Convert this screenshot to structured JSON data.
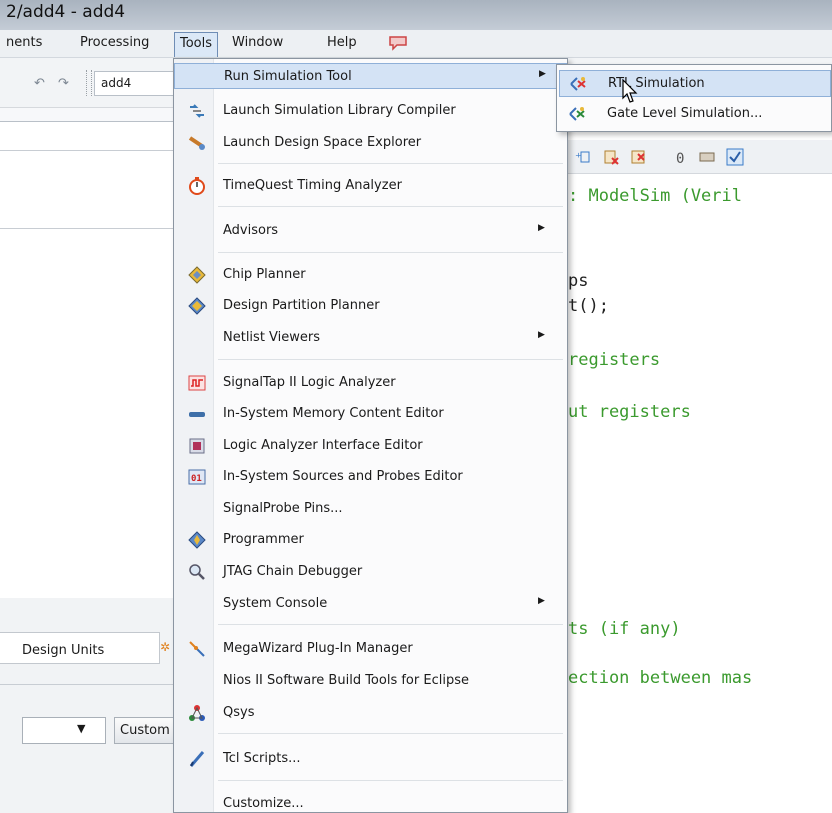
{
  "window": {
    "title": "2/add4 - add4"
  },
  "menubar": {
    "items": [
      "nents",
      "Processing",
      "Tools",
      "Window",
      "Help"
    ],
    "active": "Tools",
    "icon": "chat-bubble-icon"
  },
  "toolbar": {
    "undo_icon": "undo-icon",
    "redo_icon": "redo-icon",
    "project_value": "add4"
  },
  "tools_menu": {
    "items": [
      {
        "label": "Run Simulation Tool",
        "icon": "",
        "submenu": true,
        "highlighted": true
      },
      {
        "label": "Launch Simulation Library Compiler",
        "icon": "library-compiler-icon"
      },
      {
        "label": "Launch Design Space Explorer",
        "icon": "design-space-explorer-icon"
      },
      {
        "label": "TimeQuest Timing Analyzer",
        "icon": "stopwatch-icon"
      },
      {
        "label": "Advisors",
        "icon": "",
        "submenu": true
      },
      {
        "label": "Chip Planner",
        "icon": "chip-planner-icon"
      },
      {
        "label": "Design Partition Planner",
        "icon": "partition-planner-icon"
      },
      {
        "label": "Netlist Viewers",
        "icon": "",
        "submenu": true
      },
      {
        "label": "SignalTap II Logic Analyzer",
        "icon": "signaltap-icon"
      },
      {
        "label": "In-System Memory Content Editor",
        "icon": "memory-editor-icon"
      },
      {
        "label": "Logic Analyzer Interface Editor",
        "icon": "logic-analyzer-icon"
      },
      {
        "label": "In-System Sources and Probes Editor",
        "icon": "sources-probes-icon"
      },
      {
        "label": "SignalProbe Pins...",
        "icon": ""
      },
      {
        "label": "Programmer",
        "icon": "programmer-icon"
      },
      {
        "label": "JTAG Chain Debugger",
        "icon": "jtag-debugger-icon"
      },
      {
        "label": "System Console",
        "icon": "",
        "submenu": true
      },
      {
        "label": "MegaWizard Plug-In Manager",
        "icon": "megawizard-icon"
      },
      {
        "label": "Nios II Software Build Tools for Eclipse",
        "icon": ""
      },
      {
        "label": "Qsys",
        "icon": "qsys-icon"
      },
      {
        "label": "Tcl Scripts...",
        "icon": "tcl-scripts-icon"
      },
      {
        "label": "Customize...",
        "icon": ""
      }
    ]
  },
  "submenu": {
    "items": [
      {
        "label": "RTL Simulation",
        "icon": "rtl-simulation-icon",
        "highlighted": true
      },
      {
        "label": "Gate Level Simulation...",
        "icon": "gate-level-simulation-icon"
      }
    ]
  },
  "editor": {
    "lines": [
      {
        "text": ": ModelSim (Veril",
        "color": "#3b9a2e"
      },
      {
        "text": "ps",
        "color": "#222222"
      },
      {
        "text": "t();",
        "color": "#222222"
      },
      {
        "text": "registers",
        "color": "#3b9a2e"
      },
      {
        "text": "ut registers",
        "color": "#3b9a2e"
      },
      {
        "text": "ts (if any)",
        "color": "#3b9a2e"
      },
      {
        "text": "ection between mas",
        "color": "#3b9a2e"
      }
    ]
  },
  "bottom_panel": {
    "tab_label": "Design Units",
    "combo_arrow": "▼",
    "button_label": "Custom"
  }
}
